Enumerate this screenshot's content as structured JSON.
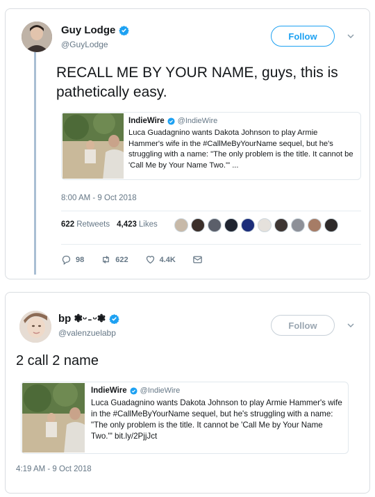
{
  "tweet1": {
    "author_name": "Guy Lodge",
    "author_handle": "@GuyLodge",
    "follow_label": "Follow",
    "text": "RECALL ME BY YOUR NAME, guys, this is pathetically easy.",
    "quote": {
      "name": "IndieWire",
      "handle": "@IndieWire",
      "text": "Luca Guadagnino wants Dakota Johnson to play Armie Hammer's wife in the #CallMeByYourName sequel, but he's struggling with a name: \"The only problem is the title. It cannot be 'Call Me by Your Name Two.'\" ..."
    },
    "timestamp": "8:00 AM - 9 Oct 2018",
    "retweets_count": "622",
    "retweets_label": "Retweets",
    "likes_count": "4,423",
    "likes_label": "Likes",
    "actions": {
      "replies": "98",
      "retweets": "622",
      "likes": "4.4K"
    }
  },
  "tweet2": {
    "author_name": "bp ❃ᵕ ̵ ᵕ❃",
    "author_handle": "@valenzuelabp",
    "follow_label": "Follow",
    "text": "2 call 2 name",
    "quote": {
      "name": "IndieWire",
      "handle": "@IndieWire",
      "text": "Luca Guadagnino wants Dakota Johnson to play Armie Hammer's wife in the #CallMeByYourName sequel, but he's struggling with a name: \"The only problem is the title. It cannot be 'Call Me by Your Name Two.'\" bit.ly/2PjjJct"
    },
    "timestamp": "4:19 AM - 9 Oct 2018"
  },
  "colors": {
    "accent": "#1da1f2",
    "secondary_text": "#657786",
    "thread_line": "#a9bed3"
  },
  "icons": [
    "verified-badge-icon",
    "chevron-down-icon",
    "reply-icon",
    "retweet-icon",
    "heart-icon",
    "message-icon"
  ]
}
